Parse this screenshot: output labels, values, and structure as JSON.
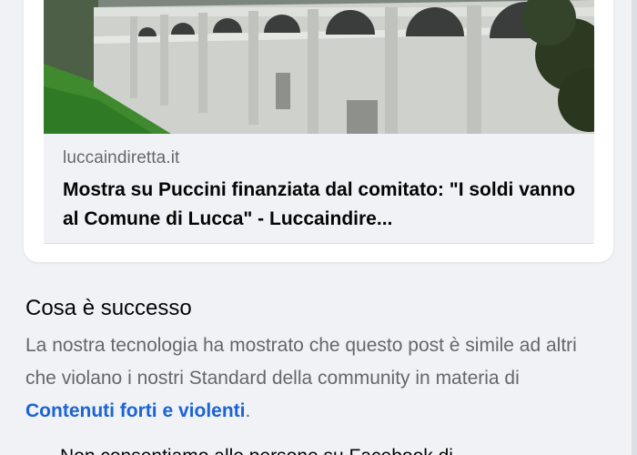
{
  "link_preview": {
    "domain": "luccaindiretta.it",
    "title": "Mostra su Puccini finanziata dal comitato: \"I soldi vanno al Comune di Lucca\" - Luccaindire..."
  },
  "what_happened": {
    "heading": "Cosa è successo",
    "body_before_link": "La nostra tecnologia ha mostrato che questo post è simile ad altri che violano i nostri Standard della community in materia di ",
    "link_text": "Contenuti forti e violenti",
    "body_after_link": ".",
    "next_paragraph_partial": "Non consentiamo alle persone su Facebook di"
  }
}
